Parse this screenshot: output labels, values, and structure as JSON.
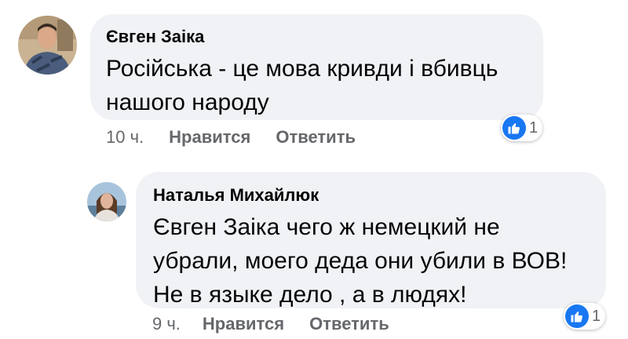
{
  "comments": [
    {
      "author": "Євген Заіка",
      "lines": [
        "Російська - це мова кривди і вбивць",
        "нашого народу"
      ],
      "time": "10 ч.",
      "like_label": "Нравится",
      "reply_label": "Ответить",
      "reaction_icon": "thumbs-up-icon",
      "reaction_count": "1"
    },
    {
      "author": "Наталья Михайлюк",
      "lines": [
        "Євген Заіка  чего ж немецкий не",
        "убрали, моего деда они убили в ВОВ!",
        "Не в языке дело , а в людях!"
      ],
      "time": "9 ч.",
      "like_label": "Нравится",
      "reply_label": "Ответить",
      "reaction_icon": "thumbs-up-icon",
      "reaction_count": "1"
    }
  ],
  "colors": {
    "bubble": "#f0f2f5",
    "meta_text": "#65676b",
    "like_blue": "#1877f2"
  }
}
